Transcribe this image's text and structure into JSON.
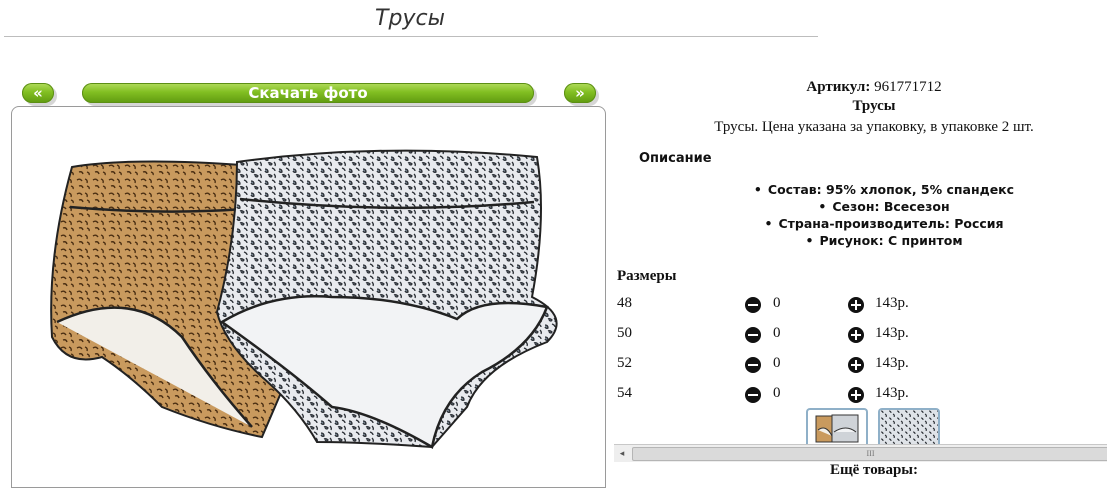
{
  "page": {
    "title": "Трусы"
  },
  "nav": {
    "prev_label": "«",
    "download_label": "Скачать фото",
    "next_label": "»"
  },
  "product": {
    "article_label": "Артикул:",
    "article_value": "961771712",
    "name": "Трусы",
    "description": "Трусы. Цена указана за упаковку, в упаковке 2 шт.",
    "description_heading": "Описание",
    "specs": [
      "Состав: 95% хлопок, 5% спандекс",
      "Сезон: Всесезон",
      "Страна-производитель: Россия",
      "Рисунок: С принтом"
    ]
  },
  "sizes": {
    "heading": "Размеры",
    "rows": [
      {
        "size": "48",
        "qty": "0",
        "price": "143р."
      },
      {
        "size": "50",
        "qty": "0",
        "price": "143р."
      },
      {
        "size": "52",
        "qty": "0",
        "price": "143р."
      },
      {
        "size": "54",
        "qty": "0",
        "price": "143р."
      }
    ]
  },
  "scrollbar": {
    "left_arrow": "◂",
    "grip": "III"
  },
  "footer": {
    "more_goods": "Ещё товары:"
  },
  "icons": {
    "minus": "minus-circle-icon",
    "plus": "plus-circle-icon"
  },
  "colors": {
    "button_green": "#82bf22",
    "thumb_border": "#8fb0c8"
  }
}
